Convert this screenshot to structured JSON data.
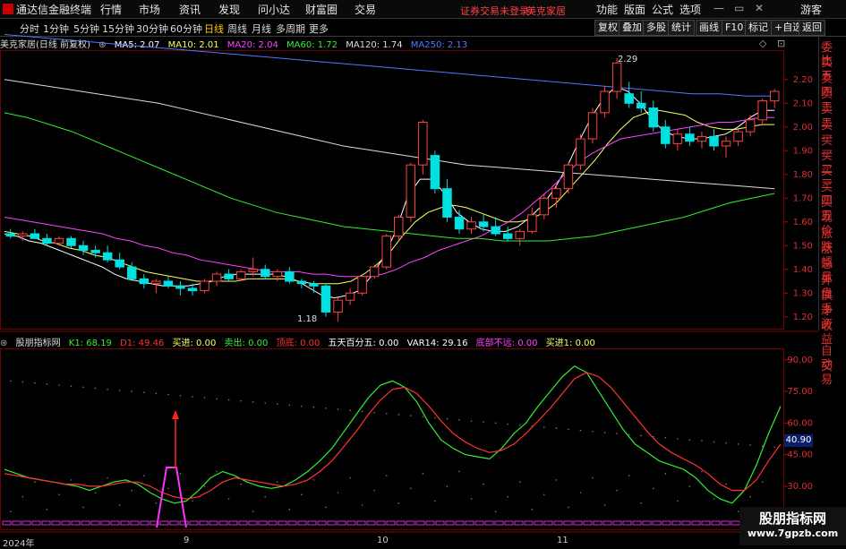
{
  "menubar": {
    "app": "通达信金融终端",
    "items": [
      "行情",
      "市场",
      "资讯",
      "发现",
      "问小达",
      "财富圈",
      "交易"
    ],
    "login_notice": "证券交易未登录",
    "stock": "美克家居",
    "right_items": [
      "功能",
      "版面",
      "公式",
      "选项"
    ],
    "guest": "游客"
  },
  "toolbar": {
    "periods": [
      "分时",
      "1分钟",
      "5分钟",
      "15分钟",
      "30分钟",
      "60分钟",
      "日线",
      "周线",
      "月线",
      "多周期",
      "更多"
    ],
    "active_period": "日线",
    "right_buttons": [
      "复权",
      "叠加",
      "多股",
      "统计",
      "画线",
      "F10",
      "标记",
      "+自选",
      "返回"
    ]
  },
  "main_chart": {
    "title": "美克家居(日线 前复权)",
    "legend": [
      {
        "label": "MA5: 2.07",
        "color": "#ffffff"
      },
      {
        "label": "MA10: 2.01",
        "color": "#ffff66"
      },
      {
        "label": "MA20: 2.04",
        "color": "#ff44ff"
      },
      {
        "label": "MA60: 1.72",
        "color": "#33ee33"
      },
      {
        "label": "MA120: 1.74",
        "color": "#dddddd"
      },
      {
        "label": "MA250: 2.13",
        "color": "#5577ff"
      }
    ],
    "high_label": "2.29",
    "low_label": "1.18"
  },
  "sub_chart": {
    "title": "股朋指标网",
    "legend": [
      {
        "label": "K1: 68.19",
        "color": "#33ee33"
      },
      {
        "label": "D1: 49.46",
        "color": "#ff3333"
      },
      {
        "label": "买进: 0.00",
        "color": "#ffff66"
      },
      {
        "label": "卖出: 0.00",
        "color": "#33ee33"
      },
      {
        "label": "顶底: 0.00",
        "color": "#ff3333"
      },
      {
        "label": "五天百分五: 0.00",
        "color": "#ffffff"
      },
      {
        "label": "VAR14: 29.16",
        "color": "#ffffff"
      },
      {
        "label": "底部不远: 0.00",
        "color": "#ff44ff"
      },
      {
        "label": "买进1: 0.00",
        "color": "#ffff66"
      }
    ],
    "marker": "40.90"
  },
  "right_panel": [
    "委比",
    "卖五",
    "卖四",
    "卖三",
    "卖二",
    "卖一",
    "买一",
    "买二",
    "买三",
    "买四",
    "买五",
    "现价",
    "涨跌",
    "涨幅",
    "总量",
    "外盘",
    "换手",
    "净资",
    "收益"
  ],
  "right_panel_sub": [
    "自动",
    "交易"
  ],
  "x_axis": [
    "2024年",
    "9",
    "10",
    "11"
  ],
  "watermark": {
    "line1": "股朋指标网",
    "line2": "www.7gpzb.com"
  },
  "chart_data": [
    {
      "type": "candlestick",
      "title": "美克家居(日线 前复权)",
      "ylim": [
        1.15,
        2.32
      ],
      "yticks": [
        2.2,
        2.1,
        2.0,
        1.9,
        1.8,
        1.7,
        1.6,
        1.5,
        1.4,
        1.3,
        1.2
      ],
      "ohlc": [
        [
          1.55,
          1.57,
          1.53,
          1.54
        ],
        [
          1.54,
          1.56,
          1.52,
          1.55
        ],
        [
          1.55,
          1.57,
          1.53,
          1.53
        ],
        [
          1.53,
          1.55,
          1.5,
          1.51
        ],
        [
          1.51,
          1.54,
          1.5,
          1.53
        ],
        [
          1.53,
          1.54,
          1.49,
          1.5
        ],
        [
          1.5,
          1.52,
          1.46,
          1.48
        ],
        [
          1.48,
          1.5,
          1.45,
          1.47
        ],
        [
          1.47,
          1.5,
          1.43,
          1.44
        ],
        [
          1.44,
          1.47,
          1.4,
          1.41
        ],
        [
          1.41,
          1.43,
          1.35,
          1.36
        ],
        [
          1.36,
          1.38,
          1.32,
          1.34
        ],
        [
          1.34,
          1.36,
          1.3,
          1.35
        ],
        [
          1.35,
          1.37,
          1.32,
          1.33
        ],
        [
          1.33,
          1.35,
          1.29,
          1.32
        ],
        [
          1.32,
          1.34,
          1.29,
          1.31
        ],
        [
          1.31,
          1.36,
          1.3,
          1.35
        ],
        [
          1.35,
          1.39,
          1.33,
          1.38
        ],
        [
          1.38,
          1.4,
          1.35,
          1.36
        ],
        [
          1.36,
          1.4,
          1.35,
          1.39
        ],
        [
          1.39,
          1.45,
          1.37,
          1.4
        ],
        [
          1.4,
          1.42,
          1.36,
          1.37
        ],
        [
          1.37,
          1.4,
          1.35,
          1.39
        ],
        [
          1.39,
          1.41,
          1.34,
          1.35
        ],
        [
          1.35,
          1.36,
          1.32,
          1.34
        ],
        [
          1.34,
          1.35,
          1.3,
          1.33
        ],
        [
          1.33,
          1.34,
          1.2,
          1.22
        ],
        [
          1.22,
          1.28,
          1.18,
          1.27
        ],
        [
          1.27,
          1.32,
          1.25,
          1.3
        ],
        [
          1.3,
          1.38,
          1.29,
          1.37
        ],
        [
          1.37,
          1.42,
          1.36,
          1.41
        ],
        [
          1.41,
          1.55,
          1.4,
          1.54
        ],
        [
          1.54,
          1.63,
          1.52,
          1.62
        ],
        [
          1.62,
          1.85,
          1.6,
          1.84
        ],
        [
          1.84,
          2.03,
          1.8,
          2.02
        ],
        [
          1.88,
          1.9,
          1.72,
          1.74
        ],
        [
          1.74,
          1.78,
          1.6,
          1.62
        ],
        [
          1.62,
          1.65,
          1.55,
          1.57
        ],
        [
          1.57,
          1.62,
          1.55,
          1.6
        ],
        [
          1.6,
          1.63,
          1.56,
          1.58
        ],
        [
          1.58,
          1.62,
          1.54,
          1.55
        ],
        [
          1.55,
          1.58,
          1.52,
          1.53
        ],
        [
          1.53,
          1.57,
          1.5,
          1.56
        ],
        [
          1.56,
          1.66,
          1.55,
          1.63
        ],
        [
          1.63,
          1.72,
          1.61,
          1.7
        ],
        [
          1.7,
          1.76,
          1.66,
          1.74
        ],
        [
          1.74,
          1.85,
          1.72,
          1.84
        ],
        [
          1.84,
          1.97,
          1.82,
          1.95
        ],
        [
          1.95,
          2.08,
          1.93,
          2.06
        ],
        [
          2.06,
          2.17,
          2.04,
          2.15
        ],
        [
          2.15,
          2.29,
          2.12,
          2.27
        ],
        [
          2.14,
          2.19,
          2.08,
          2.1
        ],
        [
          2.1,
          2.15,
          2.06,
          2.08
        ],
        [
          2.08,
          2.11,
          1.98,
          2.0
        ],
        [
          2.0,
          2.03,
          1.91,
          1.93
        ],
        [
          1.93,
          1.99,
          1.9,
          1.97
        ],
        [
          1.97,
          2.0,
          1.92,
          1.94
        ],
        [
          1.94,
          1.98,
          1.91,
          1.96
        ],
        [
          1.96,
          1.99,
          1.9,
          1.92
        ],
        [
          1.92,
          1.96,
          1.87,
          1.94
        ],
        [
          1.94,
          1.99,
          1.92,
          1.98
        ],
        [
          1.98,
          2.05,
          1.96,
          2.03
        ],
        [
          2.03,
          2.12,
          2.01,
          2.11
        ],
        [
          2.11,
          2.16,
          2.08,
          2.15
        ]
      ],
      "series": [
        {
          "name": "MA5",
          "color": "#ffffff",
          "values": [
            1.55,
            1.54,
            1.52,
            1.51,
            1.49,
            1.47,
            1.45,
            1.43,
            1.41,
            1.38,
            1.36,
            1.35,
            1.34,
            1.33,
            1.33,
            1.33,
            1.34,
            1.35,
            1.37,
            1.38,
            1.38,
            1.38,
            1.38,
            1.37,
            1.35,
            1.32,
            1.29,
            1.28,
            1.29,
            1.31,
            1.37,
            1.45,
            1.56,
            1.71,
            1.78,
            1.78,
            1.72,
            1.64,
            1.6,
            1.57,
            1.56,
            1.56,
            1.58,
            1.62,
            1.67,
            1.74,
            1.83,
            1.94,
            2.04,
            2.12,
            2.17,
            2.15,
            2.1,
            2.03,
            1.98,
            1.96,
            1.95,
            1.95,
            1.96,
            1.97,
            2.0,
            2.04,
            2.07,
            2.07
          ]
        },
        {
          "name": "MA10",
          "color": "#ffff66",
          "values": [
            1.56,
            1.55,
            1.54,
            1.52,
            1.51,
            1.49,
            1.48,
            1.46,
            1.45,
            1.43,
            1.41,
            1.39,
            1.38,
            1.37,
            1.36,
            1.35,
            1.35,
            1.35,
            1.35,
            1.36,
            1.36,
            1.36,
            1.36,
            1.35,
            1.34,
            1.34,
            1.34,
            1.35,
            1.38,
            1.42,
            1.47,
            1.54,
            1.6,
            1.64,
            1.66,
            1.67,
            1.66,
            1.64,
            1.62,
            1.6,
            1.6,
            1.61,
            1.64,
            1.68,
            1.74,
            1.8,
            1.86,
            1.93,
            1.99,
            2.04,
            2.06,
            2.07,
            2.06,
            2.05,
            2.02,
            2.0,
            1.99,
            1.99,
            2.0,
            2.01,
            2.01
          ]
        },
        {
          "name": "MA20",
          "color": "#ff44ff",
          "values": [
            1.62,
            1.61,
            1.6,
            1.59,
            1.58,
            1.57,
            1.56,
            1.55,
            1.53,
            1.52,
            1.5,
            1.49,
            1.47,
            1.46,
            1.44,
            1.43,
            1.42,
            1.41,
            1.4,
            1.39,
            1.39,
            1.39,
            1.38,
            1.38,
            1.37,
            1.37,
            1.37,
            1.38,
            1.4,
            1.43,
            1.45,
            1.48,
            1.5,
            1.52,
            1.54,
            1.57,
            1.6,
            1.64,
            1.69,
            1.74,
            1.8,
            1.85,
            1.89,
            1.92,
            1.95,
            1.96,
            1.97,
            1.98,
            1.99,
            2.0,
            2.01,
            2.02,
            2.02,
            2.03,
            2.04,
            2.04
          ]
        },
        {
          "name": "MA60",
          "color": "#33ee33",
          "values": [
            2.06,
            2.04,
            2.01,
            1.98,
            1.94,
            1.9,
            1.86,
            1.82,
            1.78,
            1.74,
            1.7,
            1.67,
            1.64,
            1.62,
            1.6,
            1.58,
            1.57,
            1.56,
            1.55,
            1.54,
            1.53,
            1.53,
            1.52,
            1.52,
            1.52,
            1.53,
            1.54,
            1.56,
            1.58,
            1.6,
            1.62,
            1.65,
            1.68,
            1.7,
            1.72
          ]
        },
        {
          "name": "MA120",
          "color": "#dddddd",
          "values": [
            2.2,
            2.18,
            2.16,
            2.14,
            2.12,
            2.1,
            2.07,
            2.04,
            2.01,
            1.98,
            1.95,
            1.92,
            1.9,
            1.88,
            1.86,
            1.84,
            1.83,
            1.82,
            1.81,
            1.8,
            1.79,
            1.78,
            1.77,
            1.76,
            1.75,
            1.74
          ]
        },
        {
          "name": "MA250",
          "color": "#5577ff",
          "values": [
            2.39,
            2.38,
            2.37,
            2.36,
            2.35,
            2.34,
            2.33,
            2.32,
            2.31,
            2.3,
            2.29,
            2.28,
            2.27,
            2.26,
            2.25,
            2.24,
            2.23,
            2.22,
            2.21,
            2.2,
            2.19,
            2.18,
            2.17,
            2.16,
            2.15,
            2.14,
            2.14,
            2.13,
            2.13
          ]
        }
      ]
    },
    {
      "type": "line",
      "title": "股朋指标网",
      "ylim": [
        10,
        95
      ],
      "yticks": [
        90,
        75,
        60,
        45,
        30,
        15
      ],
      "series": [
        {
          "name": "K1",
          "color": "#33ee33",
          "values": [
            38,
            36,
            34,
            33,
            32,
            31,
            30,
            28,
            30,
            32,
            33,
            31,
            27,
            24,
            22,
            23,
            28,
            34,
            37,
            35,
            32,
            30,
            29,
            30,
            33,
            37,
            42,
            48,
            56,
            64,
            72,
            78,
            80,
            77,
            70,
            60,
            52,
            48,
            45,
            44,
            43,
            48,
            55,
            60,
            68,
            75,
            82,
            87,
            84,
            75,
            66,
            57,
            50,
            46,
            42,
            40,
            38,
            34,
            28,
            24,
            22,
            28,
            40,
            55,
            68
          ]
        },
        {
          "name": "D1",
          "color": "#ff3333",
          "values": [
            36,
            35,
            34,
            33,
            32,
            31,
            31,
            30,
            30,
            31,
            32,
            32,
            30,
            27,
            25,
            24,
            25,
            28,
            32,
            34,
            33,
            32,
            31,
            30,
            31,
            33,
            37,
            42,
            49,
            56,
            64,
            71,
            76,
            77,
            74,
            68,
            61,
            55,
            51,
            48,
            46,
            47,
            50,
            55,
            61,
            67,
            74,
            81,
            84,
            82,
            77,
            70,
            63,
            56,
            50,
            46,
            43,
            40,
            36,
            31,
            28,
            28,
            33,
            42,
            50
          ]
        }
      ]
    }
  ]
}
